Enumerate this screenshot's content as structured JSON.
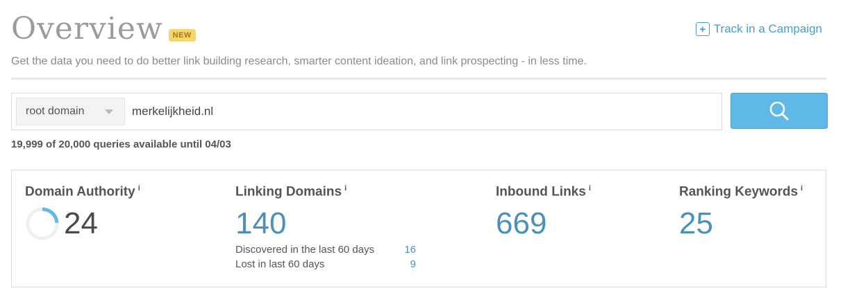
{
  "header": {
    "title": "Overview",
    "badge": "NEW",
    "track_link": "Track in a Campaign",
    "subtitle": "Get the data you need to do better link building research, smarter content ideation, and link prospecting - in less time."
  },
  "search": {
    "scope_selected": "root domain",
    "query_value": "merkelijkheid.nl",
    "quota_text": "19,999 of 20,000 queries available until 04/03"
  },
  "metrics": {
    "info_glyph": "i",
    "domain_authority": {
      "label": "Domain Authority",
      "value": "24",
      "gauge_fraction": 0.24
    },
    "linking_domains": {
      "label": "Linking Domains",
      "value": "140",
      "discovered_label": "Discovered in the last 60 days",
      "discovered_value": "16",
      "lost_label": "Lost in last 60 days",
      "lost_value": "9"
    },
    "inbound_links": {
      "label": "Inbound Links",
      "value": "669"
    },
    "ranking_keywords": {
      "label": "Ranking Keywords",
      "value": "25"
    }
  },
  "colors": {
    "accent": "#4a90b8",
    "search_button": "#5fb8e6",
    "badge": "#f9d66b"
  }
}
